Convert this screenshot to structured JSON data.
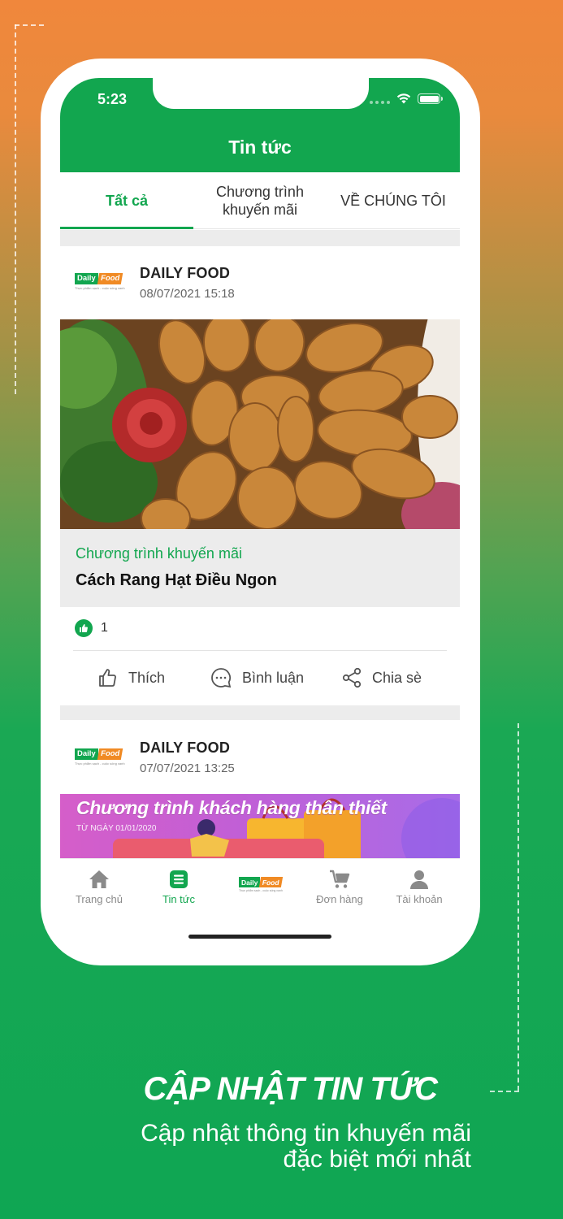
{
  "status_bar": {
    "time": "5:23"
  },
  "header": {
    "title": "Tin tức"
  },
  "tabs": [
    {
      "label": "Tất cả",
      "active": true
    },
    {
      "label": "Chương trình khuyến mãi",
      "active": false
    },
    {
      "label": "VỀ CHÚNG TÔI",
      "active": false
    }
  ],
  "posts": [
    {
      "source": "DAILY FOOD",
      "date": "08/07/2021 15:18",
      "category": "Chương trình khuyến mãi",
      "title": "Cách Rang Hạt Điều Ngon",
      "likes": "1",
      "actions": {
        "like": "Thích",
        "comment": "Bình luận",
        "share": "Chia sè"
      }
    },
    {
      "source": "DAILY FOOD",
      "date": "07/07/2021 13:25",
      "banner_title": "Chương trình khách hàng thân thiết",
      "banner_sub": "TỪ NGÀY 01/01/2020"
    }
  ],
  "logo": {
    "part1": "Daily",
    "part2": "Food",
    "tagline": "Thực phẩm sạch - cuộc sống xanh"
  },
  "bottom_nav": [
    {
      "label": "Trang chủ",
      "icon": "home-icon",
      "active": false
    },
    {
      "label": "Tin tức",
      "icon": "news-icon",
      "active": true
    },
    {
      "label": "",
      "icon": "daily-food-logo",
      "active": false
    },
    {
      "label": "Đơn hàng",
      "icon": "cart-icon",
      "active": false
    },
    {
      "label": "Tài khoản",
      "icon": "user-icon",
      "active": false
    }
  ],
  "promo": {
    "heading": "CẬP NHẬT TIN TỨC",
    "line1": "Cập nhật thông tin khuyến mãi",
    "line2": "đặc biệt mới nhất"
  },
  "colors": {
    "brand_green": "#12a64f",
    "brand_orange": "#f08a24"
  }
}
